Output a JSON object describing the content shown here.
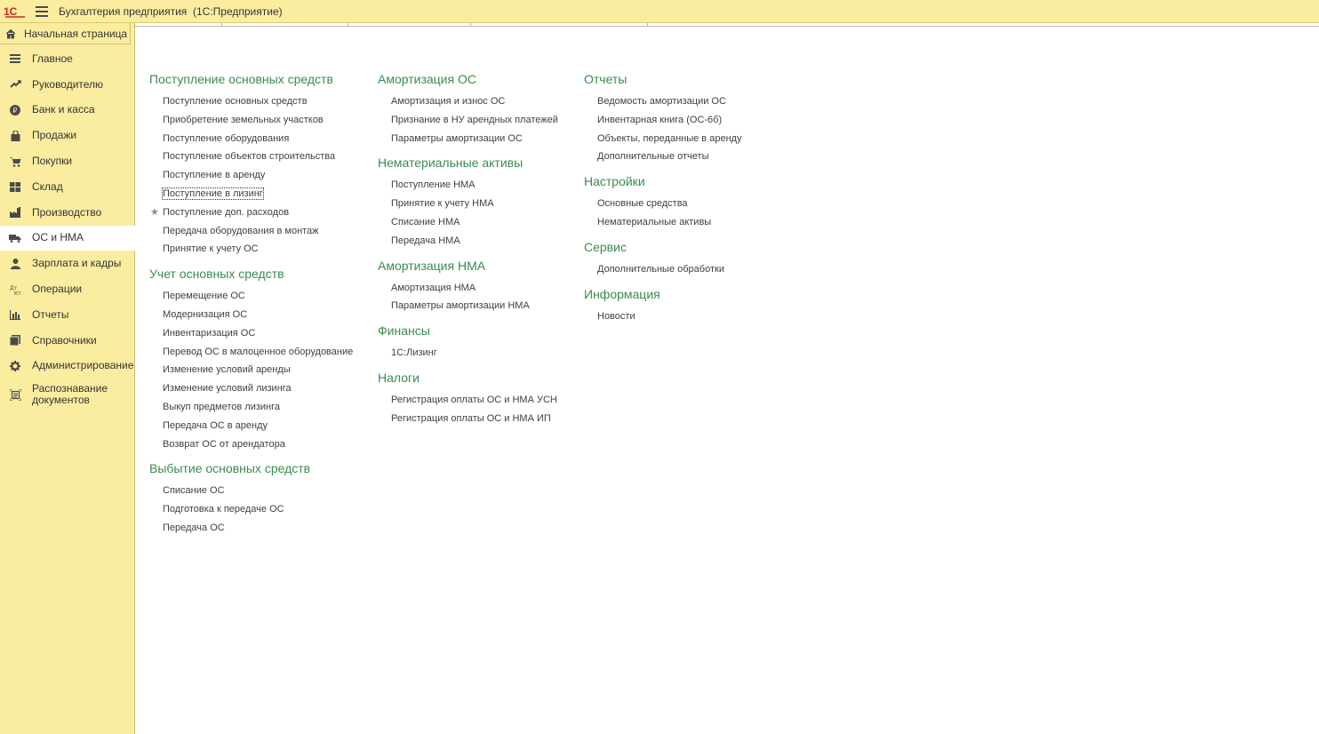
{
  "app": {
    "title": "Бухгалтерия предприятия",
    "subtitle": "(1С:Предприятие)"
  },
  "sidebar": {
    "home": "Начальная страница",
    "items": [
      {
        "label": "Главное",
        "icon": "menu-lines-icon"
      },
      {
        "label": "Руководителю",
        "icon": "trend-up-icon"
      },
      {
        "label": "Банк и касса",
        "icon": "ruble-coin-icon"
      },
      {
        "label": "Продажи",
        "icon": "shopping-bag-icon"
      },
      {
        "label": "Покупки",
        "icon": "cart-icon"
      },
      {
        "label": "Склад",
        "icon": "warehouse-grid-icon"
      },
      {
        "label": "Производство",
        "icon": "factory-icon"
      },
      {
        "label": "ОС и НМА",
        "icon": "truck-icon",
        "active": true
      },
      {
        "label": "Зарплата и кадры",
        "icon": "person-icon"
      },
      {
        "label": "Операции",
        "icon": "dt-kt-icon"
      },
      {
        "label": "Отчеты",
        "icon": "bar-chart-icon"
      },
      {
        "label": "Справочники",
        "icon": "books-icon"
      },
      {
        "label": "Администрирование",
        "icon": "gear-icon"
      },
      {
        "label": "Распознавание документов",
        "icon": "scan-document-icon"
      }
    ]
  },
  "columns": [
    [
      {
        "title": "Поступление основных средств",
        "links": [
          "Поступление основных средств",
          "Приобретение земельных участков",
          "Поступление оборудования",
          "Поступление объектов строительства",
          "Поступление в аренду",
          "Поступление в лизинг",
          "Поступление доп. расходов",
          "Передача оборудования в монтаж",
          "Принятие к учету ОС"
        ]
      },
      {
        "title": "Учет основных средств",
        "links": [
          "Перемещение ОС",
          "Модернизация ОС",
          "Инвентаризация ОС",
          "Перевод ОС в малоценное оборудование",
          "Изменение условий аренды",
          "Изменение условий лизинга",
          "Выкуп предметов лизинга",
          "Передача ОС в аренду",
          "Возврат ОС от арендатора"
        ]
      },
      {
        "title": "Выбытие основных средств",
        "links": [
          "Списание ОС",
          "Подготовка к передаче ОС",
          "Передача ОС"
        ]
      }
    ],
    [
      {
        "title": "Амортизация ОС",
        "links": [
          "Амортизация и износ ОС",
          "Признание в НУ арендных платежей",
          "Параметры амортизации ОС"
        ]
      },
      {
        "title": "Нематериальные активы",
        "links": [
          "Поступление НМА",
          "Принятие к учету НМА",
          "Списание НМА",
          "Передача НМА"
        ]
      },
      {
        "title": "Амортизация НМА",
        "links": [
          "Амортизация НМА",
          "Параметры амортизации НМА"
        ]
      },
      {
        "title": "Финансы",
        "links": [
          "1С:Лизинг"
        ]
      },
      {
        "title": "Налоги",
        "links": [
          "Регистрация оплаты ОС и НМА УСН",
          "Регистрация оплаты ОС и НМА ИП"
        ]
      }
    ],
    [
      {
        "title": "Отчеты",
        "links": [
          "Ведомость амортизации ОС",
          "Инвентарная книга (ОС-6б)",
          "Объекты, переданные в аренду",
          "Дополнительные отчеты"
        ]
      },
      {
        "title": "Настройки",
        "links": [
          "Основные средства",
          "Нематериальные активы"
        ]
      },
      {
        "title": "Сервис",
        "links": [
          "Дополнительные обработки"
        ]
      },
      {
        "title": "Информация",
        "links": [
          "Новости"
        ]
      }
    ]
  ],
  "focused_link": "Поступление в лизинг",
  "starred_link": "Поступление доп. расходов",
  "colors": {
    "accent_yellow": "#fbeda0",
    "group_title_green": "#3a8c4d",
    "link_text": "#404040"
  }
}
